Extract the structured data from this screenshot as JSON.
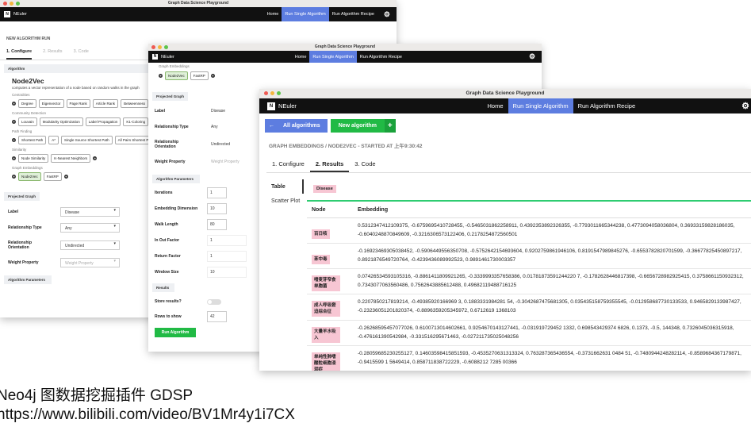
{
  "app": {
    "window_title": "Graph Data Science Playground",
    "brand": "NEuler",
    "nav": {
      "home": "Home",
      "run_single": "Run Single Algorithm",
      "run_recipe": "Run Algorithm Recipe"
    }
  },
  "w1": {
    "header": "NEW ALGORITHM RUN",
    "tabs": [
      "1. Configure",
      "2. Results",
      "3. Code"
    ],
    "algorithm_section": "Algorithm",
    "algo_name": "Node2Vec",
    "algo_desc": "computes a vector representation of a node based on random walks in the graph",
    "groups": [
      {
        "title": "Centralities",
        "items": [
          "Degree",
          "Eigenvector",
          "Page Rank",
          "Article Rank",
          "Betweenness"
        ]
      },
      {
        "title": "Community Detection",
        "items": [
          "Louvain",
          "Modularity Optimization",
          "Label Propagation",
          "K1-Coloring"
        ]
      },
      {
        "title": "Path Finding",
        "items": [
          "Shortest Path",
          "A*",
          "Single Source Shortest Path",
          "All Pairs Shortest Path"
        ]
      },
      {
        "title": "Similarity",
        "items": [
          "Node Similarity",
          "K-Nearest Neighbors"
        ]
      },
      {
        "title": "Graph Embeddings",
        "items": [
          "Node2Vec",
          "FastRP"
        ]
      }
    ],
    "projected_graph": "Projected Graph",
    "fields": [
      {
        "label": "Label",
        "value": "Disease"
      },
      {
        "label": "Relationship Type",
        "value": "Any"
      },
      {
        "label": "Relationship Orientation",
        "value": "Undirected"
      },
      {
        "label": "Weight Property",
        "value": "Weight Property"
      }
    ],
    "algorithm_parameters": "Algorithm Parameters"
  },
  "w2": {
    "embeddings_title": "Graph Embeddings",
    "embeddings_items": [
      "Node2Vec",
      "FastRP"
    ],
    "projected_graph": "Projected Graph",
    "fields": [
      {
        "label": "Label",
        "value": "Disease"
      },
      {
        "label": "Relationship Type",
        "value": "Any"
      },
      {
        "label": "Relationship Orientation",
        "value": "Undirected"
      },
      {
        "label": "Weight Property",
        "value": "Weight Property"
      }
    ],
    "algorithm_parameters": "Algorithm Parameters",
    "params": [
      {
        "label": "Iterations",
        "value": "1"
      },
      {
        "label": "Embedding Dimension",
        "value": "10"
      },
      {
        "label": "Walk Length",
        "value": "80"
      },
      {
        "label": "In Out Factor",
        "value": "1"
      },
      {
        "label": "Return Factor",
        "value": "1"
      },
      {
        "label": "Window Size",
        "value": "10"
      }
    ],
    "results_section": "Results",
    "store_label": "Store results?",
    "rows_label": "Rows to show",
    "rows_value": "42",
    "run_button": "Run Algorithm"
  },
  "w3": {
    "all_algorithms": "All algorithms",
    "new_algorithm": "New algorithm",
    "breadcrumb": "GRAPH EMBEDDINGS / NODE2VEC - STARTED AT 上午9:30:42",
    "tabs": [
      "1. Configure",
      "2. Results",
      "3. Code"
    ],
    "view_table": "Table",
    "view_scatter": "Scatter Plot",
    "filter_badge": "Disease",
    "col_node": "Node",
    "col_embedding": "Embedding",
    "rows": [
      {
        "node": "百日咳",
        "embedding": "0.5312347412109375, -0.6759695410728455, -0.5465031862258911, 0.4392353892326355, -0.7793011665344238, 0.4773094058036804, 0.36933159828186035, -0.6040248870849609, -0.3216306573122406, 0.2178254872560501"
      },
      {
        "node": "苯中毒",
        "embedding": "-0.16923469305038452, -0.5906449556350708, -0.5752642154693604, 0.9202759861946106, 0.8191547989845276, -0.6553782820701599, -0.36677825450897217, 0.8921876549720764, -0.4239436089992523, 0.9891461730003357"
      },
      {
        "node": "嗜麦芽窄食单胞菌",
        "embedding": "0.07426534593105316, -0.8861411809921265, -0.3339993357658386, 0.01781873591244220 7, -0.1782628446817398, -0.6656728982925415, 0.3758661150932312, 0.7343077063560486, 0.7562643885612488, 0.49682119488716125"
      },
      {
        "node": "成人呼吸窘迫综合征",
        "embedding": "0.2207850217819214, -0.49385920166969 3, 0.1883331984281 54, -0.3042687475681305, 0.035435158759355545, -0.012958687730133533, 0.9465829133987427, -0.23236051201820374, -0.8896359205345972, 0.6712619 1368103"
      },
      {
        "node": "大量羊水吸入",
        "embedding": "-0.26268595457077026, 0.6100713014602661, 0.9254670143127441, -0.031919729452 1332, 0.698543429374 6826, 0.1373, -0.5, 144348, 0.7326045036315918, -0.476161390542984, -0.331516295671463, -0.027211735025048256"
      },
      {
        "node": "单纯性肺嗜酸粒细胞浸润症",
        "embedding": "-0.28059685230255127, 0.14603598415851593, -0.4535270631313324, 0.763287365436554, -0.3731662631 0484 51, -0.7480944248282114, -0.8589684367179871, -0.9415599 1 5649414, 0.858711838722229, -0.6088212 7285 00366"
      }
    ]
  },
  "caption": {
    "line1": "Neo4j 图数据挖掘插件 GDSP",
    "line2": "https://www.bilibili.com/video/BV1Mr4y1i7CX"
  }
}
